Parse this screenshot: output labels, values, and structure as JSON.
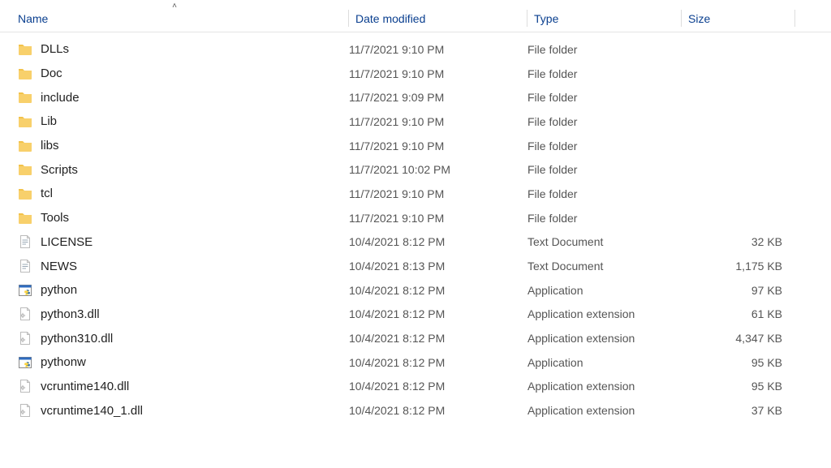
{
  "columns": {
    "name": "Name",
    "date": "Date modified",
    "type": "Type",
    "size": "Size"
  },
  "sorted_column": "name",
  "sort_direction": "asc",
  "items": [
    {
      "icon": "folder",
      "name": "DLLs",
      "date": "11/7/2021 9:10 PM",
      "type": "File folder",
      "size": ""
    },
    {
      "icon": "folder",
      "name": "Doc",
      "date": "11/7/2021 9:10 PM",
      "type": "File folder",
      "size": ""
    },
    {
      "icon": "folder",
      "name": "include",
      "date": "11/7/2021 9:09 PM",
      "type": "File folder",
      "size": ""
    },
    {
      "icon": "folder",
      "name": "Lib",
      "date": "11/7/2021 9:10 PM",
      "type": "File folder",
      "size": ""
    },
    {
      "icon": "folder",
      "name": "libs",
      "date": "11/7/2021 9:10 PM",
      "type": "File folder",
      "size": ""
    },
    {
      "icon": "folder",
      "name": "Scripts",
      "date": "11/7/2021 10:02 PM",
      "type": "File folder",
      "size": ""
    },
    {
      "icon": "folder",
      "name": "tcl",
      "date": "11/7/2021 9:10 PM",
      "type": "File folder",
      "size": ""
    },
    {
      "icon": "folder",
      "name": "Tools",
      "date": "11/7/2021 9:10 PM",
      "type": "File folder",
      "size": ""
    },
    {
      "icon": "text",
      "name": "LICENSE",
      "date": "10/4/2021 8:12 PM",
      "type": "Text Document",
      "size": "32 KB"
    },
    {
      "icon": "text",
      "name": "NEWS",
      "date": "10/4/2021 8:13 PM",
      "type": "Text Document",
      "size": "1,175 KB"
    },
    {
      "icon": "pyexe",
      "name": "python",
      "date": "10/4/2021 8:12 PM",
      "type": "Application",
      "size": "97 KB"
    },
    {
      "icon": "dll",
      "name": "python3.dll",
      "date": "10/4/2021 8:12 PM",
      "type": "Application extension",
      "size": "61 KB"
    },
    {
      "icon": "dll",
      "name": "python310.dll",
      "date": "10/4/2021 8:12 PM",
      "type": "Application extension",
      "size": "4,347 KB"
    },
    {
      "icon": "pyexe",
      "name": "pythonw",
      "date": "10/4/2021 8:12 PM",
      "type": "Application",
      "size": "95 KB"
    },
    {
      "icon": "dll",
      "name": "vcruntime140.dll",
      "date": "10/4/2021 8:12 PM",
      "type": "Application extension",
      "size": "95 KB"
    },
    {
      "icon": "dll",
      "name": "vcruntime140_1.dll",
      "date": "10/4/2021 8:12 PM",
      "type": "Application extension",
      "size": "37 KB"
    }
  ],
  "icon_colors": {
    "folder_main": "#f8d06b",
    "folder_tab": "#f2c24a",
    "text_page": "#ffffff",
    "text_border": "#bbbbbb",
    "text_lines": "#9aa8b5",
    "dll_page": "#ffffff",
    "dll_border": "#bbbbbb",
    "dll_gear": "#b8b8b8",
    "py_window": "#ffffff",
    "py_titlebar": "#2f6cc0",
    "py_border": "#8a8a8a",
    "py_blue": "#3572A5",
    "py_yellow": "#FFD43B"
  }
}
